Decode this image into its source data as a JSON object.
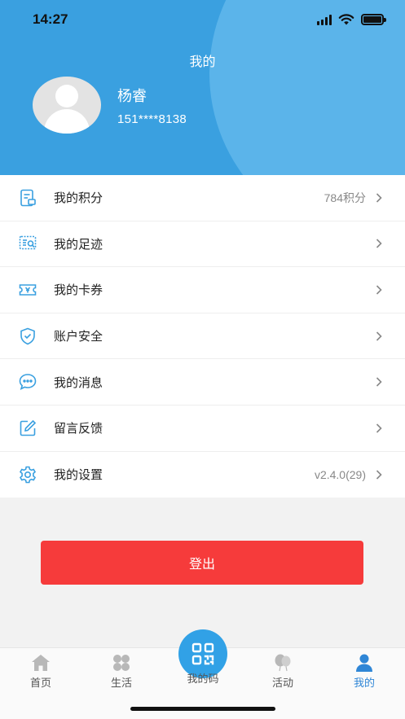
{
  "status_bar": {
    "time": "14:27"
  },
  "header": {
    "title": "我的",
    "user_name": "杨睿",
    "phone": "151****8138"
  },
  "menu": [
    {
      "label": "我的积分",
      "value": "784积分",
      "icon": "points-icon"
    },
    {
      "label": "我的足迹",
      "value": "",
      "icon": "footprint-icon"
    },
    {
      "label": "我的卡券",
      "value": "",
      "icon": "coupon-icon"
    },
    {
      "label": "账户安全",
      "value": "",
      "icon": "shield-icon"
    },
    {
      "label": "我的消息",
      "value": "",
      "icon": "message-icon"
    },
    {
      "label": "留言反馈",
      "value": "",
      "icon": "edit-icon"
    },
    {
      "label": "我的设置",
      "value": "v2.4.0(29)",
      "icon": "gear-icon"
    }
  ],
  "logout_label": "登出",
  "tabs": [
    {
      "label": "首页",
      "icon": "home-icon"
    },
    {
      "label": "生活",
      "icon": "clover-icon"
    },
    {
      "label": "我的码",
      "icon": "qrcode-icon"
    },
    {
      "label": "活动",
      "icon": "balloon-icon"
    },
    {
      "label": "我的",
      "icon": "person-icon",
      "active": true
    }
  ],
  "colors": {
    "header_bg": "#3aa0e0",
    "logout_bg": "#f63b3b",
    "tab_active": "#2f86d6",
    "menu_icon": "#3aa0e0"
  }
}
